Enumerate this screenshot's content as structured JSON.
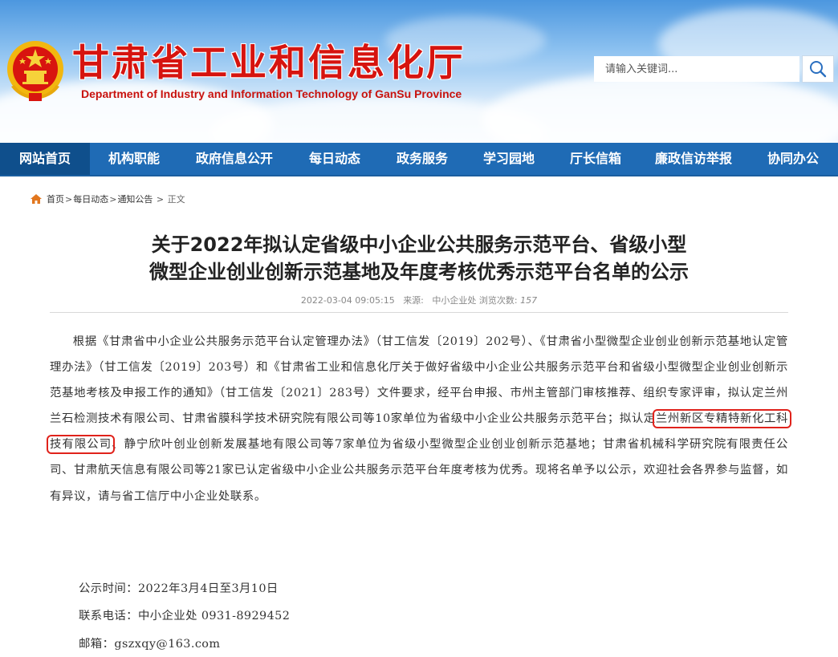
{
  "header": {
    "title": "甘肃省工业和信息化厅",
    "subtitle": "Department of Industry and Information Technology of GanSu Province",
    "search_placeholder": "请输入关键词...",
    "emblem_icon": "national-emblem-icon",
    "search_icon": "magnifier-icon"
  },
  "nav": {
    "items": [
      {
        "label": "网站首页"
      },
      {
        "label": "机构职能"
      },
      {
        "label": "政府信息公开"
      },
      {
        "label": "每日动态"
      },
      {
        "label": "政务服务"
      },
      {
        "label": "学习园地"
      },
      {
        "label": "厅长信箱"
      },
      {
        "label": "廉政信访举报"
      },
      {
        "label": "协同办公"
      }
    ]
  },
  "breadcrumb": {
    "home_icon": "home-icon",
    "items": [
      "首页",
      "每日动态",
      "通知公告"
    ],
    "current": "正文"
  },
  "article": {
    "title_line1": "关于2022年拟认定省级中小企业公共服务示范平台、省级小型",
    "title_line2": "微型企业创业创新示范基地及年度考核优秀示范平台名单的公示",
    "date": "2022-03-04 09:05:15",
    "source_label": "来源:",
    "source": "中小企业处",
    "views_label": "浏览次数:",
    "views": "157",
    "body_before": "根据《甘肃省中小企业公共服务示范平台认定管理办法》（甘工信发〔2019〕202号）、《甘肃省小型微型企业创业创新示范基地认定管理办法》（甘工信发〔2019〕203号）和《甘肃省工业和信息化厅关于做好省级中小企业公共服务示范平台和省级小型微型企业创业创新示范基地考核及申报工作的通知》（甘工信发〔2021〕283号）文件要求，经平台申报、市州主管部门审核推荐、组织专家评审，拟认定兰州兰石检测技术有限公司、甘肃省膜科学技术研究院有限公司等10家单位为省级中小企业公共服务示范平台；拟认定",
    "body_highlight": "兰州新区专精特新化工科技有限公司",
    "body_after": "、静宁欣叶创业创新发展基地有限公司等7家单位为省级小型微型企业创业创新示范基地；甘肃省机械科学研究院有限责任公司、甘肃航天信息有限公司等21家已认定省级中小企业公共服务示范平台年度考核为优秀。现将名单予以公示，欢迎社会各界参与监督，如有异议，请与省工信厅中小企业处联系。",
    "notice_time": "公示时间：2022年3月4日至3月10日",
    "contact_phone": "联系电话：中小企业处 0931-8929452",
    "email": "邮箱：gszxqy@163.com"
  },
  "colors": {
    "nav_bg": "#1f6bb5",
    "nav_active": "#0f4f8c",
    "title_red": "#d6140f",
    "highlight_box": "#e0221b"
  }
}
